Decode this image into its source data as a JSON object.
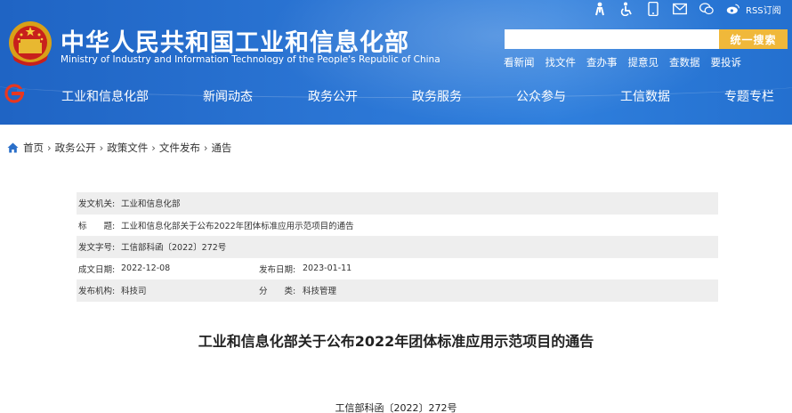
{
  "header": {
    "title_cn": "中华人民共和国工业和信息化部",
    "title_en": "Ministry of Industry and Information Technology of the People's Republic of China",
    "rss_label": "RSS订阅",
    "search": {
      "placeholder": "",
      "button_label": "统一搜索"
    },
    "quick_links": [
      "看新闻",
      "找文件",
      "查办事",
      "提意见",
      "查数据",
      "要投诉"
    ]
  },
  "nav": {
    "items": [
      "工业和信息化部",
      "新闻动态",
      "政务公开",
      "政务服务",
      "公众参与",
      "工信数据",
      "专题专栏"
    ]
  },
  "breadcrumb": [
    "首页",
    "政务公开",
    "政策文件",
    "文件发布",
    "通告"
  ],
  "info": {
    "issuer_label": "发文机关:",
    "issuer": "工业和信息化部",
    "title_label": "标　　题:",
    "title": "工业和信息化部关于公布2022年团体标准应用示范项目的通告",
    "docno_label": "发文字号:",
    "docno": "工信部科函〔2022〕272号",
    "created_label": "成文日期:",
    "created": "2022-12-08",
    "published_label": "发布日期:",
    "published": "2023-01-11",
    "org_label": "发布机构:",
    "org": "科技司",
    "category_label": "分　　类:",
    "category": "科技管理"
  },
  "document": {
    "title": "工业和信息化部关于公布2022年团体标准应用示范项目的通告",
    "number": "工信部科函〔2022〕272号"
  },
  "colors": {
    "header_blue": "#2a74d3",
    "search_button": "#f0b83a",
    "row_shade": "#eeeeee"
  }
}
